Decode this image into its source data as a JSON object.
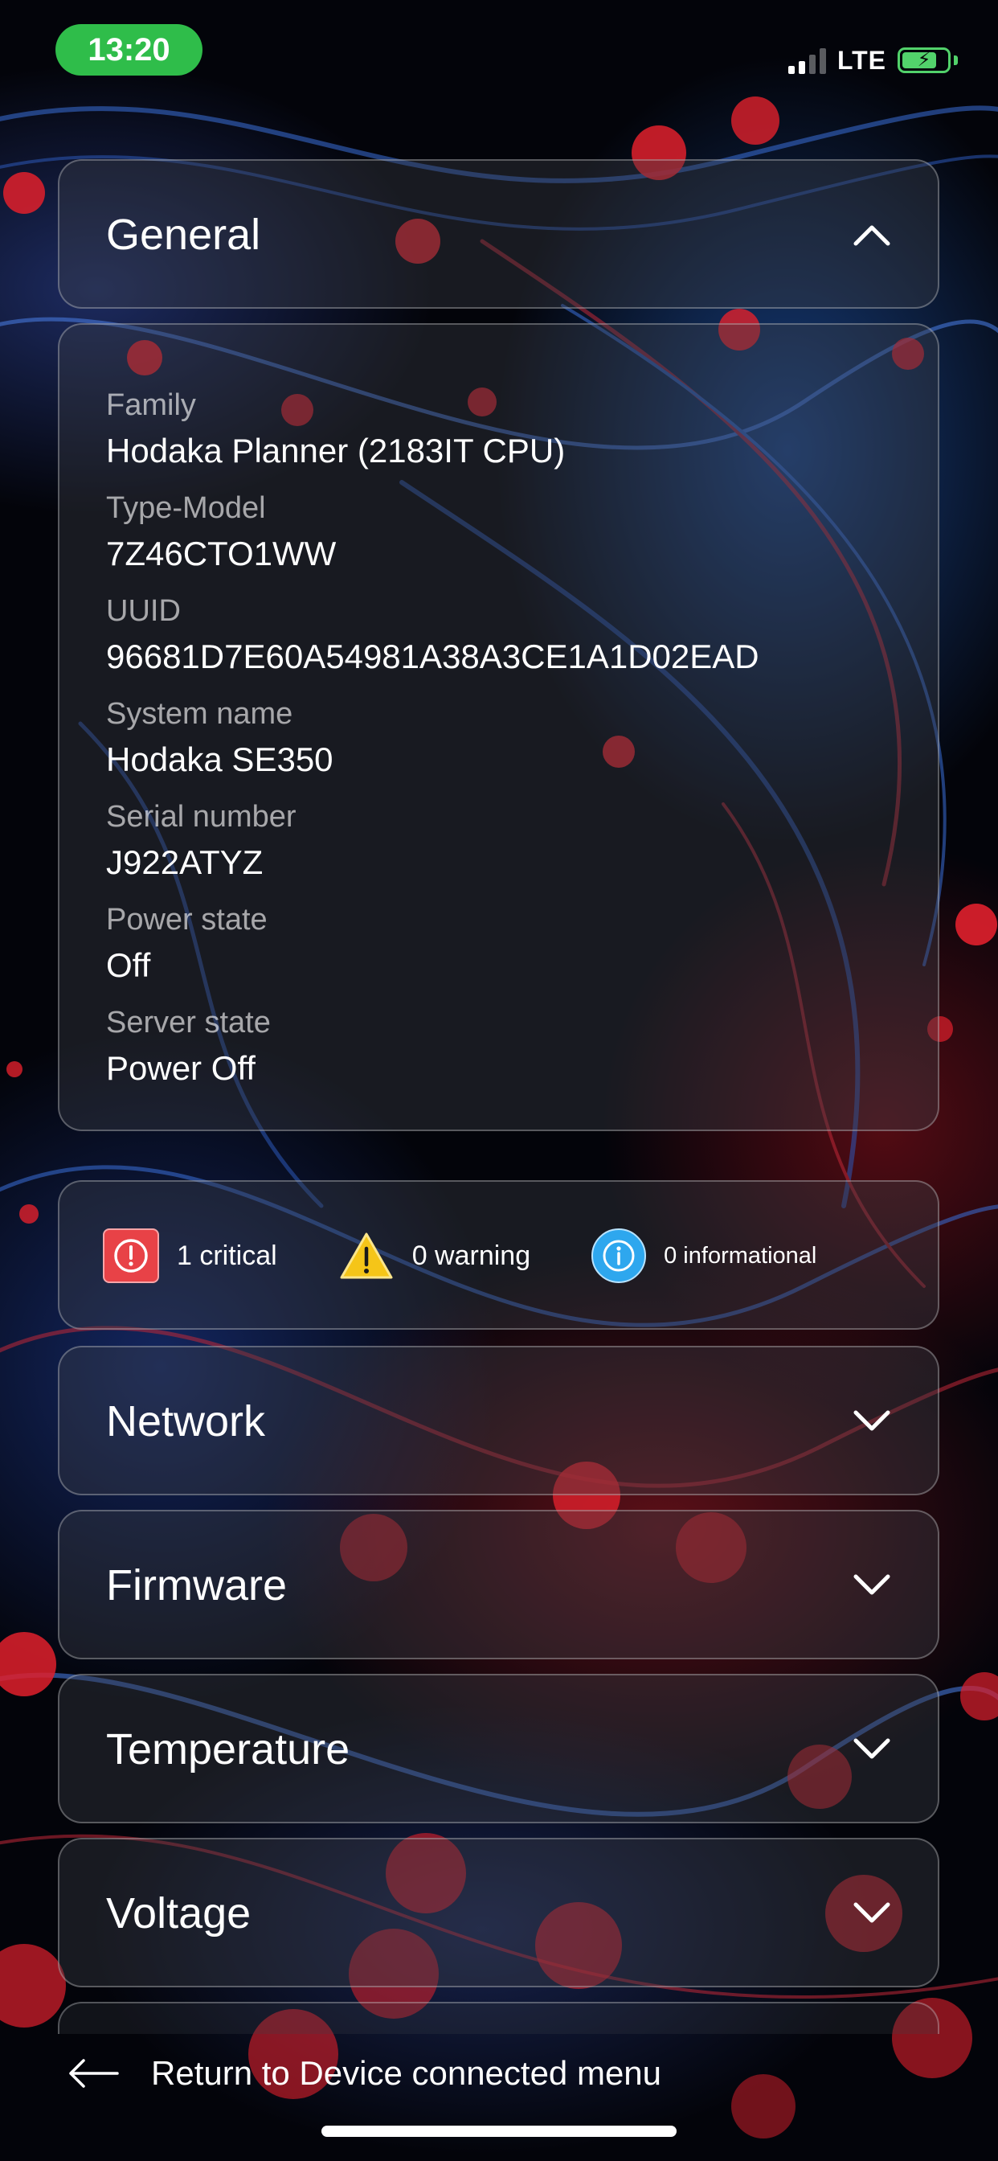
{
  "status_bar": {
    "time": "13:20",
    "network": "LTE",
    "battery_charging": true,
    "time_pill_color": "#2fbd4a",
    "battery_color": "#52d26b"
  },
  "general": {
    "title": "General",
    "expanded": true,
    "fields": [
      {
        "label": "Family",
        "value": "Hodaka Planner (2183IT CPU)"
      },
      {
        "label": "Type-Model",
        "value": "7Z46CTO1WW"
      },
      {
        "label": "UUID",
        "value": "96681D7E60A54981A38A3CE1A1D02EAD"
      },
      {
        "label": "System name",
        "value": "Hodaka SE350"
      },
      {
        "label": "Serial number",
        "value": "J922ATYZ"
      },
      {
        "label": "Power state",
        "value": "Off"
      },
      {
        "label": "Server state",
        "value": "Power Off"
      }
    ]
  },
  "alerts": {
    "critical": "1 critical",
    "warning": "0 warning",
    "informational": "0 informational",
    "critical_color": "#e84247",
    "warning_color": "#f5c518",
    "info_color": "#2ea7ee"
  },
  "sections": [
    {
      "title": "Network",
      "expanded": false
    },
    {
      "title": "Firmware",
      "expanded": false
    },
    {
      "title": "Temperature",
      "expanded": false
    },
    {
      "title": "Voltage",
      "expanded": false
    }
  ],
  "footer": {
    "return_label": "Return to Device connected menu"
  }
}
